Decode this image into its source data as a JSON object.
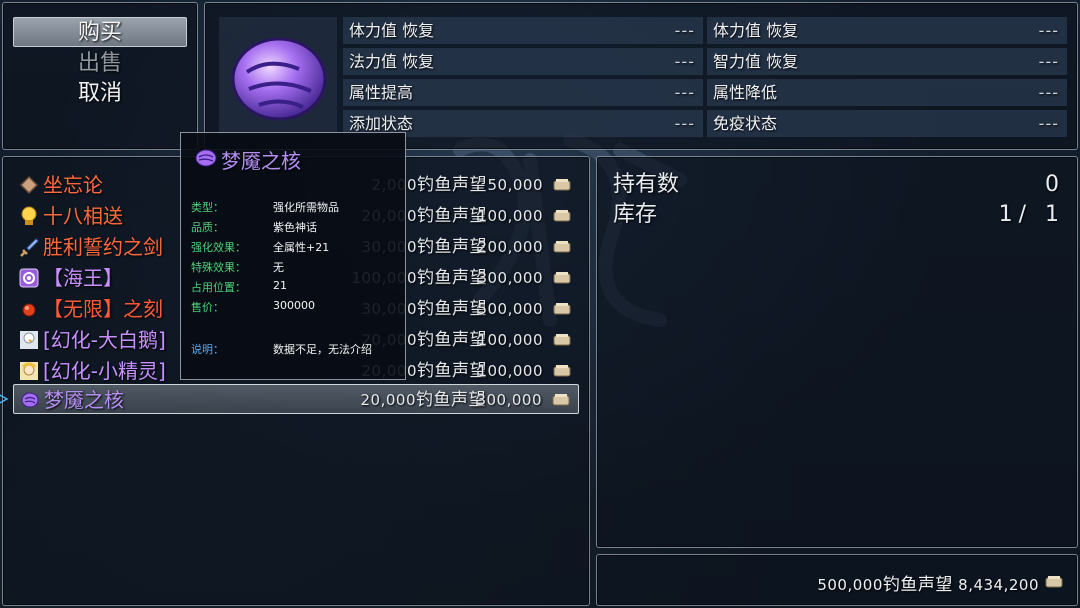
{
  "commands": [
    {
      "label": "购买",
      "selected": true,
      "enabled": true
    },
    {
      "label": "出售",
      "selected": false,
      "enabled": false
    },
    {
      "label": "取消",
      "selected": false,
      "enabled": true
    }
  ],
  "status": {
    "cells": [
      {
        "label": "体力值 恢复",
        "value": "---"
      },
      {
        "label": "体力值 恢复",
        "value": "---"
      },
      {
        "label": "法力值 恢复",
        "value": "---"
      },
      {
        "label": "智力值 恢复",
        "value": "---"
      },
      {
        "label": "属性提高",
        "value": "---"
      },
      {
        "label": "属性降低",
        "value": "---"
      },
      {
        "label": "添加状态",
        "value": "---"
      },
      {
        "label": "免疫状态",
        "value": "---"
      }
    ]
  },
  "items": [
    {
      "name": "坐忘论",
      "price": "2,000",
      "currency": "钓鱼声望",
      "cost": "50,000",
      "color": "#ff6a3d",
      "icon": "diamond-icon"
    },
    {
      "name": "十八相送",
      "price": "20,000",
      "currency": "钓鱼声望",
      "cost": "100,000",
      "color": "#ff6a3d",
      "icon": "gold-orb-icon"
    },
    {
      "name": "胜利誓约之剑",
      "price": "30,000",
      "currency": "钓鱼声望",
      "cost": "200,000",
      "color": "#ff6a3d",
      "icon": "sword-icon"
    },
    {
      "name": "【海王】",
      "price": "100,000",
      "currency": "钓鱼声望",
      "cost": "300,000",
      "color": "#c890ff",
      "icon": "purple-badge-icon"
    },
    {
      "name": "【无限】之刻",
      "price": "30,000",
      "currency": "钓鱼声望",
      "cost": "500,000",
      "color": "#ff5a3a",
      "icon": "red-gem-icon"
    },
    {
      "name": "[幻化-大白鹅]",
      "price": "20,000",
      "currency": "钓鱼声望",
      "cost": "100,000",
      "color": "#c890ff",
      "icon": "goose-portrait-icon"
    },
    {
      "name": "[幻化-小精灵]",
      "price": "20,000",
      "currency": "钓鱼声望",
      "cost": "100,000",
      "color": "#c890ff",
      "icon": "elf-portrait-icon"
    },
    {
      "name": "梦魇之核",
      "price": "20,000",
      "currency": "钓鱼声望",
      "cost": "300,000",
      "color": "#b58ff5",
      "icon": "purple-stone-icon",
      "selected": true
    }
  ],
  "info": {
    "owned_label": "持有数",
    "owned_value": "0",
    "stock_label": "库存",
    "stock_value": "1/ 1"
  },
  "gold": {
    "price": "500,000",
    "currency": "钓鱼声望",
    "amount": "8,434,200"
  },
  "tooltip": {
    "title": "梦魇之核",
    "rows": [
      {
        "key": "类型：",
        "value": "强化所需物品"
      },
      {
        "key": "品质：",
        "value": "紫色神话"
      },
      {
        "key": "强化效果：",
        "value": "全属性+21"
      },
      {
        "key": "特殊效果：",
        "value": "无"
      },
      {
        "key": "占用位置：",
        "value": "21"
      },
      {
        "key": "售价：",
        "value": "300000"
      }
    ],
    "desc_key": "说明：",
    "desc_value": "数据不足，无法介绍"
  },
  "colors": {
    "accent_orange": "#ff6a3d",
    "accent_purple": "#b58ff5",
    "tooltip_key": "#4fd07a"
  }
}
